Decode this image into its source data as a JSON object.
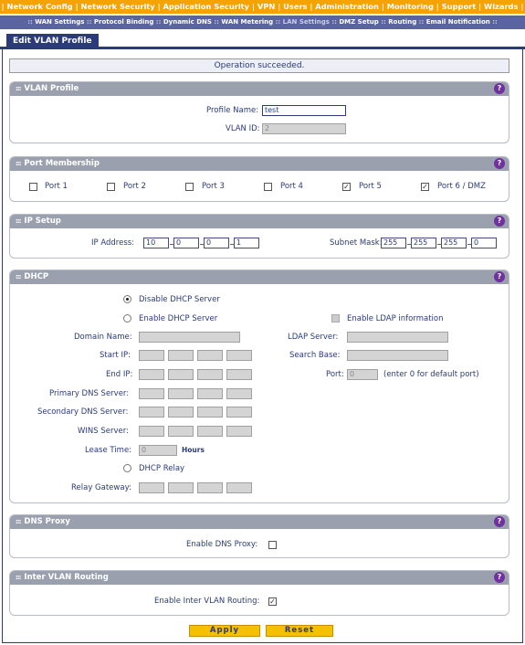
{
  "top_nav": {
    "items": [
      "Network Config",
      "Network Security",
      "Application Security",
      "VPN",
      "Users",
      "Administration",
      "Monitoring",
      "Support",
      "Wizards"
    ]
  },
  "sub_nav": {
    "items": [
      "WAN Settings",
      "Protocol Binding",
      "Dynamic DNS",
      "WAN Metering",
      "LAN Settings",
      "DMZ Setup",
      "Routing",
      "Email Notification"
    ]
  },
  "tab": {
    "label": "Edit VLAN Profile"
  },
  "status_message": "Operation succeeded.",
  "vlan_profile": {
    "title": "VLAN Profile",
    "profile_name_label": "Profile Name:",
    "profile_name_value": "test",
    "vlan_id_label": "VLAN ID:",
    "vlan_id_value": "2"
  },
  "port_membership": {
    "title": "Port Membership",
    "ports": [
      {
        "label": "Port 1",
        "checked": false
      },
      {
        "label": "Port 2",
        "checked": false
      },
      {
        "label": "Port 3",
        "checked": false
      },
      {
        "label": "Port 4",
        "checked": false
      },
      {
        "label": "Port 5",
        "checked": true
      },
      {
        "label": "Port 6 / DMZ",
        "checked": true
      }
    ]
  },
  "ip_setup": {
    "title": "IP Setup",
    "ip_label": "IP Address:",
    "ip": [
      "10",
      "0",
      "0",
      "1"
    ],
    "mask_label": "Subnet Mask:",
    "mask": [
      "255",
      "255",
      "255",
      "0"
    ]
  },
  "dhcp": {
    "title": "DHCP",
    "disable_label": "Disable DHCP Server",
    "enable_label": "Enable DHCP Server",
    "ldap_enable_label": "Enable LDAP information",
    "domain_label": "Domain Name:",
    "start_ip_label": "Start IP:",
    "end_ip_label": "End IP:",
    "primary_dns_label": "Primary DNS Server:",
    "secondary_dns_label": "Secondary DNS Server:",
    "wins_label": "WINS Server:",
    "lease_label": "Lease Time:",
    "lease_value": "0",
    "lease_unit": "Hours",
    "relay_label": "DHCP Relay",
    "relay_gateway_label": "Relay Gateway:",
    "ldap_server_label": "LDAP Server:",
    "search_base_label": "Search Base:",
    "port_label": "Port:",
    "port_value": "0",
    "port_hint": "(enter 0 for default port)"
  },
  "dns_proxy": {
    "title": "DNS Proxy",
    "label": "Enable DNS Proxy:",
    "checked": false
  },
  "inter_vlan": {
    "title": "Inter VLAN Routing",
    "label": "Enable Inter VLAN Routing:",
    "checked": true
  },
  "buttons": {
    "apply": "Apply",
    "reset": "Reset"
  },
  "colors": {
    "nav_orange": "#f5a300",
    "subnav_blue": "#5a64a0",
    "navy": "#2a3a7a",
    "section_header": "#9aa0ad",
    "button_yellow": "#f5c000",
    "help_purple": "#7030a0"
  }
}
